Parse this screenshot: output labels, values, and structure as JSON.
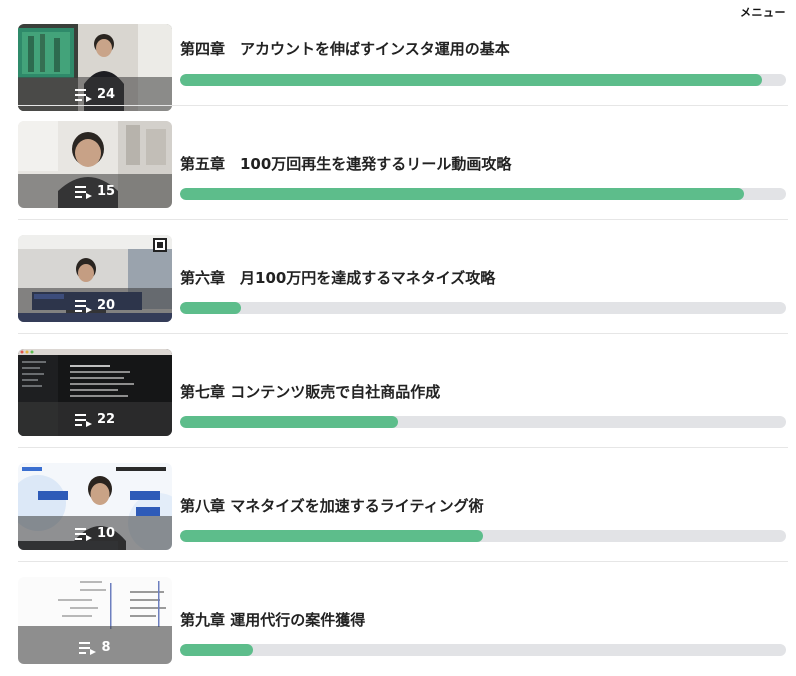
{
  "menu_label": "メニュー",
  "colors": {
    "progress_fill": "#5dbd8b",
    "progress_track": "#e2e3e6"
  },
  "chapters": [
    {
      "title": "第四章　アカウントを伸ばすインスタ運用の基本",
      "video_count": "24",
      "progress_percent": 96,
      "icon": "playlist-icon"
    },
    {
      "title": "第五章　100万回再生を連発するリール動画攻略",
      "video_count": "15",
      "progress_percent": 93,
      "icon": "playlist-icon"
    },
    {
      "title": "第六章　月100万円を達成するマネタイズ攻略",
      "video_count": "20",
      "progress_percent": 10,
      "icon": "playlist-icon"
    },
    {
      "title": "第七章 コンテンツ販売で自社商品作成",
      "video_count": "22",
      "progress_percent": 36,
      "icon": "playlist-icon"
    },
    {
      "title": "第八章 マネタイズを加速するライティング術",
      "video_count": "10",
      "progress_percent": 50,
      "icon": "playlist-icon"
    },
    {
      "title": "第九章 運用代行の案件獲得",
      "video_count": "8",
      "progress_percent": 12,
      "icon": "playlist-icon"
    }
  ]
}
